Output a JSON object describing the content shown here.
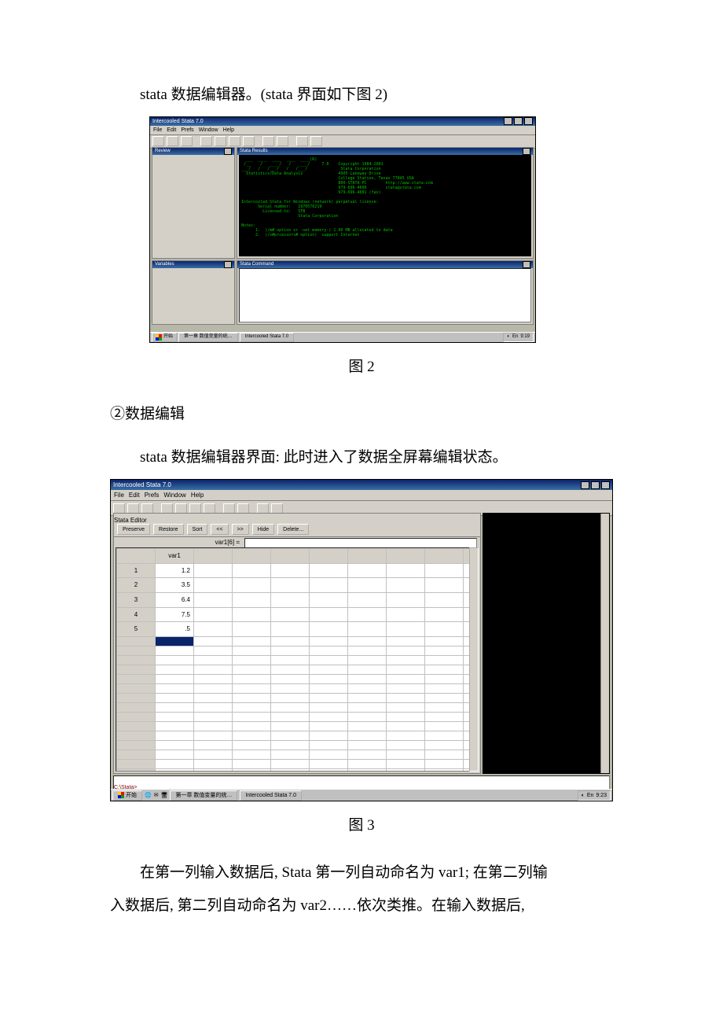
{
  "text": {
    "line1": "stata 数据编辑器。(stata 界面如下图 2)",
    "caption2": "图 2",
    "heading": "②数据编辑",
    "line2": "stata 数据编辑器界面: 此时进入了数据全屏幕编辑状态。",
    "caption3": "图 3",
    "para_a": "在第一列输入数据后, Stata 第一列自动命名为 var1; 在第二列输",
    "para_b": "入数据后, 第二列自动命名为 var2……依次类推。在输入数据后,"
  },
  "fig2": {
    "title": "Intercooled Stata 7.0",
    "menu": [
      "File",
      "Edit",
      "Prefs",
      "Window",
      "Help"
    ],
    "panes": {
      "review": "Review",
      "variables": "Variables",
      "results": "Stata Results",
      "command": "Stata Command"
    },
    "results_text": "  ___  ____  ____  ____  ____(R)\n /__    /   ____/   /   ____/     7.0    Copyright 1984-2001\n___/   /   /___/   /   /___/              Stata Corporation\n  Statistics/Data Analysis               4905 Lakeway Drive\n                                         College Station, Texas 77845 USA\n                                         800-STATA-PC        http://www.stata.com\n                                         979-696-4600        stata@stata.com\n                                         979-696-4601 (fax)\n\nIntercooled Stata for Windows (network) perpetual license:\n       Serial number:   1970576219\n         Licensed to:   STB\n                        Stata Corporation\n\nNotes:\n      1.  (/m# option or -set memory-) 1.00 MB allocated to data\n      2.  (/v#prcessors# option)  support Internet",
    "taskbar": {
      "start": "开始",
      "tasks": [
        "第一章 数值变量的统…",
        "Intercooled Stata 7.0"
      ],
      "time": "9:19"
    }
  },
  "fig3": {
    "title": "Intercooled Stata 7.0",
    "menu": [
      "File",
      "Edit",
      "Prefs",
      "Window",
      "Help"
    ],
    "editor_title": "Stata Editor",
    "ed_buttons": [
      "Preserve",
      "Restore",
      "Sort",
      "<<",
      ">>",
      "Hide",
      "Delete..."
    ],
    "cell_label": "var1[6] =",
    "col_header": "var1",
    "rows": [
      {
        "n": "1",
        "v": "1.2"
      },
      {
        "n": "2",
        "v": "3.5"
      },
      {
        "n": "3",
        "v": "6.4"
      },
      {
        "n": "4",
        "v": "7.5"
      },
      {
        "n": "5",
        "v": ".5"
      }
    ],
    "empty_rows": 20,
    "extra_cols": 8,
    "status": "C:\\Stata>",
    "taskbar": {
      "start": "开始",
      "tasks": [
        "第一章 数值变量的统…",
        "Intercooled Stata 7.0"
      ],
      "time": "9:23"
    }
  },
  "chart_data": {
    "type": "table",
    "title": "Stata Editor — var1",
    "columns": [
      "var1"
    ],
    "rows": [
      [
        1.2
      ],
      [
        3.5
      ],
      [
        6.4
      ],
      [
        7.5
      ],
      [
        0.5
      ]
    ]
  }
}
